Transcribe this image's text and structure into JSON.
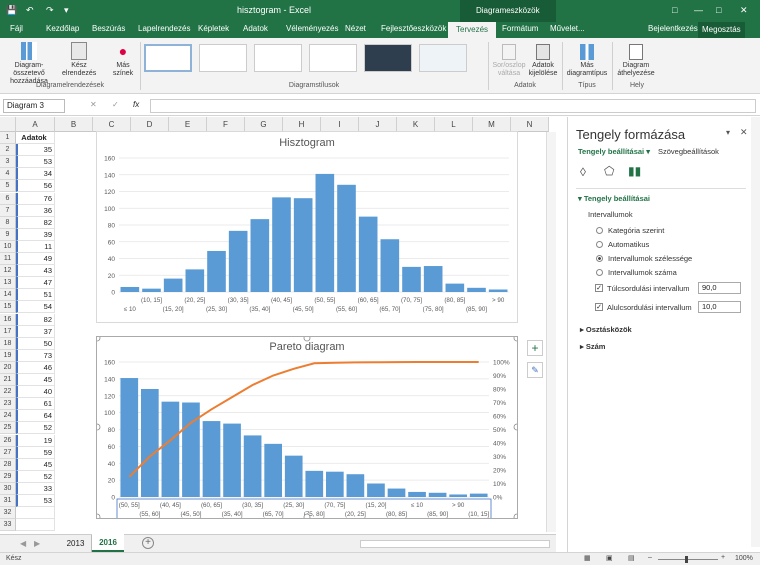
{
  "window": {
    "title": "hisztogram - Excel",
    "context_title": "Diagrameszközök"
  },
  "tabs": [
    "Fájl",
    "Kezdőlap",
    "Beszúrás",
    "Lapelrendezés",
    "Képletek",
    "Adatok",
    "Véleményezés",
    "Nézet",
    "Fejlesztőeszközök",
    "Tervezés",
    "Formátum",
    "Művelet..."
  ],
  "account": {
    "signin": "Bejelentkezés",
    "share": "Megosztás"
  },
  "ribbon": {
    "add_element": "Diagram-összetevő hozzáadása",
    "quick_layout": "Kész elrendezés",
    "change_colors": "Más színek",
    "switch_rowcol": "Sor/oszlop váltása",
    "select_data": "Adatok kijelölése",
    "change_type": "Más diagramtípus",
    "move_chart": "Diagram áthelyezése",
    "group_layouts": "Diagramelrendezések",
    "group_styles": "Diagramstílusok",
    "group_data": "Adatok",
    "group_type": "Típus",
    "group_location": "Hely"
  },
  "formula_bar": {
    "name_box": "Diagram 3",
    "fx": "fx"
  },
  "columns": [
    "A",
    "B",
    "C",
    "D",
    "E",
    "F",
    "G",
    "H",
    "I",
    "J",
    "K",
    "L",
    "M",
    "N"
  ],
  "cells": {
    "header": "Adatok",
    "values": [
      35,
      53,
      34,
      56,
      76,
      36,
      82,
      39,
      11,
      49,
      43,
      47,
      51,
      54,
      82,
      37,
      50,
      73,
      46,
      45,
      40,
      61,
      64,
      52,
      19,
      59,
      45,
      52,
      33,
      53
    ]
  },
  "sheets": [
    "2013",
    "2016"
  ],
  "status": {
    "ready": "Kész",
    "zoom": "100%"
  },
  "pane": {
    "title": "Tengely formázása",
    "tab1": "Tengely beállításai",
    "tab2": "Szövegbeállítások",
    "section": "Tengely beállításai",
    "sub": "Intervallumok",
    "opt_cat": "Kategória szerint",
    "opt_auto": "Automatikus",
    "opt_width": "Intervallumok szélessége",
    "opt_count": "Intervallumok száma",
    "overflow": "Túlcsordulási intervallum",
    "overflow_val": "90,0",
    "underflow": "Alulcsordulási intervallum",
    "underflow_val": "10,0",
    "ticks": "Osztásközök",
    "number": "Szám"
  },
  "chart_data": [
    {
      "type": "bar",
      "title": "Hisztogram",
      "categories": [
        "≤ 10",
        "(10, 15]",
        "(15, 20]",
        "(20, 25]",
        "(25, 30]",
        "(30, 35]",
        "(35, 40]",
        "(40, 45]",
        "(45, 50]",
        "(50, 55]",
        "(55, 60]",
        "(60, 65]",
        "(65, 70]",
        "(70, 75]",
        "(75, 80]",
        "(80, 85]",
        "(85, 90]",
        "> 90"
      ],
      "values": [
        6,
        4,
        16,
        27,
        49,
        73,
        87,
        113,
        112,
        141,
        128,
        90,
        63,
        30,
        31,
        10,
        5,
        3
      ],
      "ylim": [
        0,
        160
      ],
      "yticks": [
        0,
        20,
        40,
        60,
        80,
        100,
        120,
        140,
        160
      ]
    },
    {
      "type": "bar",
      "title": "Pareto diagram",
      "categories": [
        "(50, 55]",
        "(55, 60]",
        "(40, 45]",
        "(45, 50]",
        "(60, 65]",
        "(35, 40]",
        "(30, 35]",
        "(65, 70]",
        "(25, 30]",
        "(75, 80]",
        "(70, 75]",
        "(20, 25]",
        "(15, 20]",
        "(80, 85]",
        "≤ 10",
        "(85, 90]",
        "> 90",
        "(10, 15]"
      ],
      "values": [
        141,
        128,
        113,
        112,
        90,
        87,
        73,
        63,
        49,
        31,
        30,
        27,
        16,
        10,
        6,
        5,
        3,
        4
      ],
      "cumulative_pct": [
        15,
        30,
        42,
        55,
        65,
        74,
        83,
        90,
        95,
        99,
        99.5,
        99.7,
        99.8,
        99.9,
        100,
        100,
        100,
        100
      ],
      "ylim": [
        0,
        160
      ],
      "yticks": [
        0,
        20,
        40,
        60,
        80,
        100,
        120,
        140,
        160
      ],
      "y2ticks": [
        "0%",
        "10%",
        "20%",
        "30%",
        "40%",
        "50%",
        "60%",
        "70%",
        "80%",
        "90%",
        "100%"
      ],
      "colors": {
        "bars": "#5b9bd5",
        "line": "#ed7d31"
      }
    }
  ]
}
